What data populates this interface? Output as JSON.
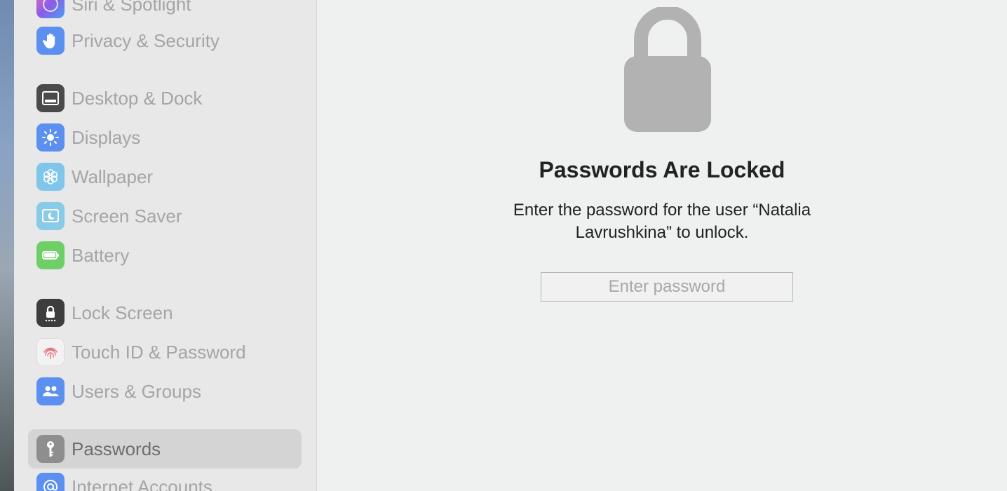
{
  "sidebar": {
    "items": [
      {
        "label": "Siri & Spotlight",
        "icon": "siri-icon",
        "color": "#b06ad8"
      },
      {
        "label": "Privacy & Security",
        "icon": "hand-icon",
        "color": "#5b8ff0"
      },
      {
        "label": "Desktop & Dock",
        "icon": "dock-icon",
        "color": "#4a4a4a"
      },
      {
        "label": "Displays",
        "icon": "sun-icon",
        "color": "#5b8ff0"
      },
      {
        "label": "Wallpaper",
        "icon": "flower-icon",
        "color": "#7fc6ea"
      },
      {
        "label": "Screen Saver",
        "icon": "screensaver-icon",
        "color": "#87cbe8"
      },
      {
        "label": "Battery",
        "icon": "battery-icon",
        "color": "#6fcf67"
      },
      {
        "label": "Lock Screen",
        "icon": "lock-icon",
        "color": "#3d3d3d"
      },
      {
        "label": "Touch ID & Password",
        "icon": "fingerprint-icon",
        "color": "#f2f2f2"
      },
      {
        "label": "Users & Groups",
        "icon": "users-icon",
        "color": "#5b8ff0"
      },
      {
        "label": "Passwords",
        "icon": "key-icon",
        "color": "#8e8e8e"
      },
      {
        "label": "Internet Accounts",
        "icon": "at-icon",
        "color": "#5b8ff0"
      }
    ],
    "selected": "Passwords"
  },
  "main": {
    "title": "Passwords Are Locked",
    "description": "Enter the password for the user “Natalia Lavrushkina” to unlock.",
    "password_placeholder": "Enter password",
    "password_value": ""
  }
}
